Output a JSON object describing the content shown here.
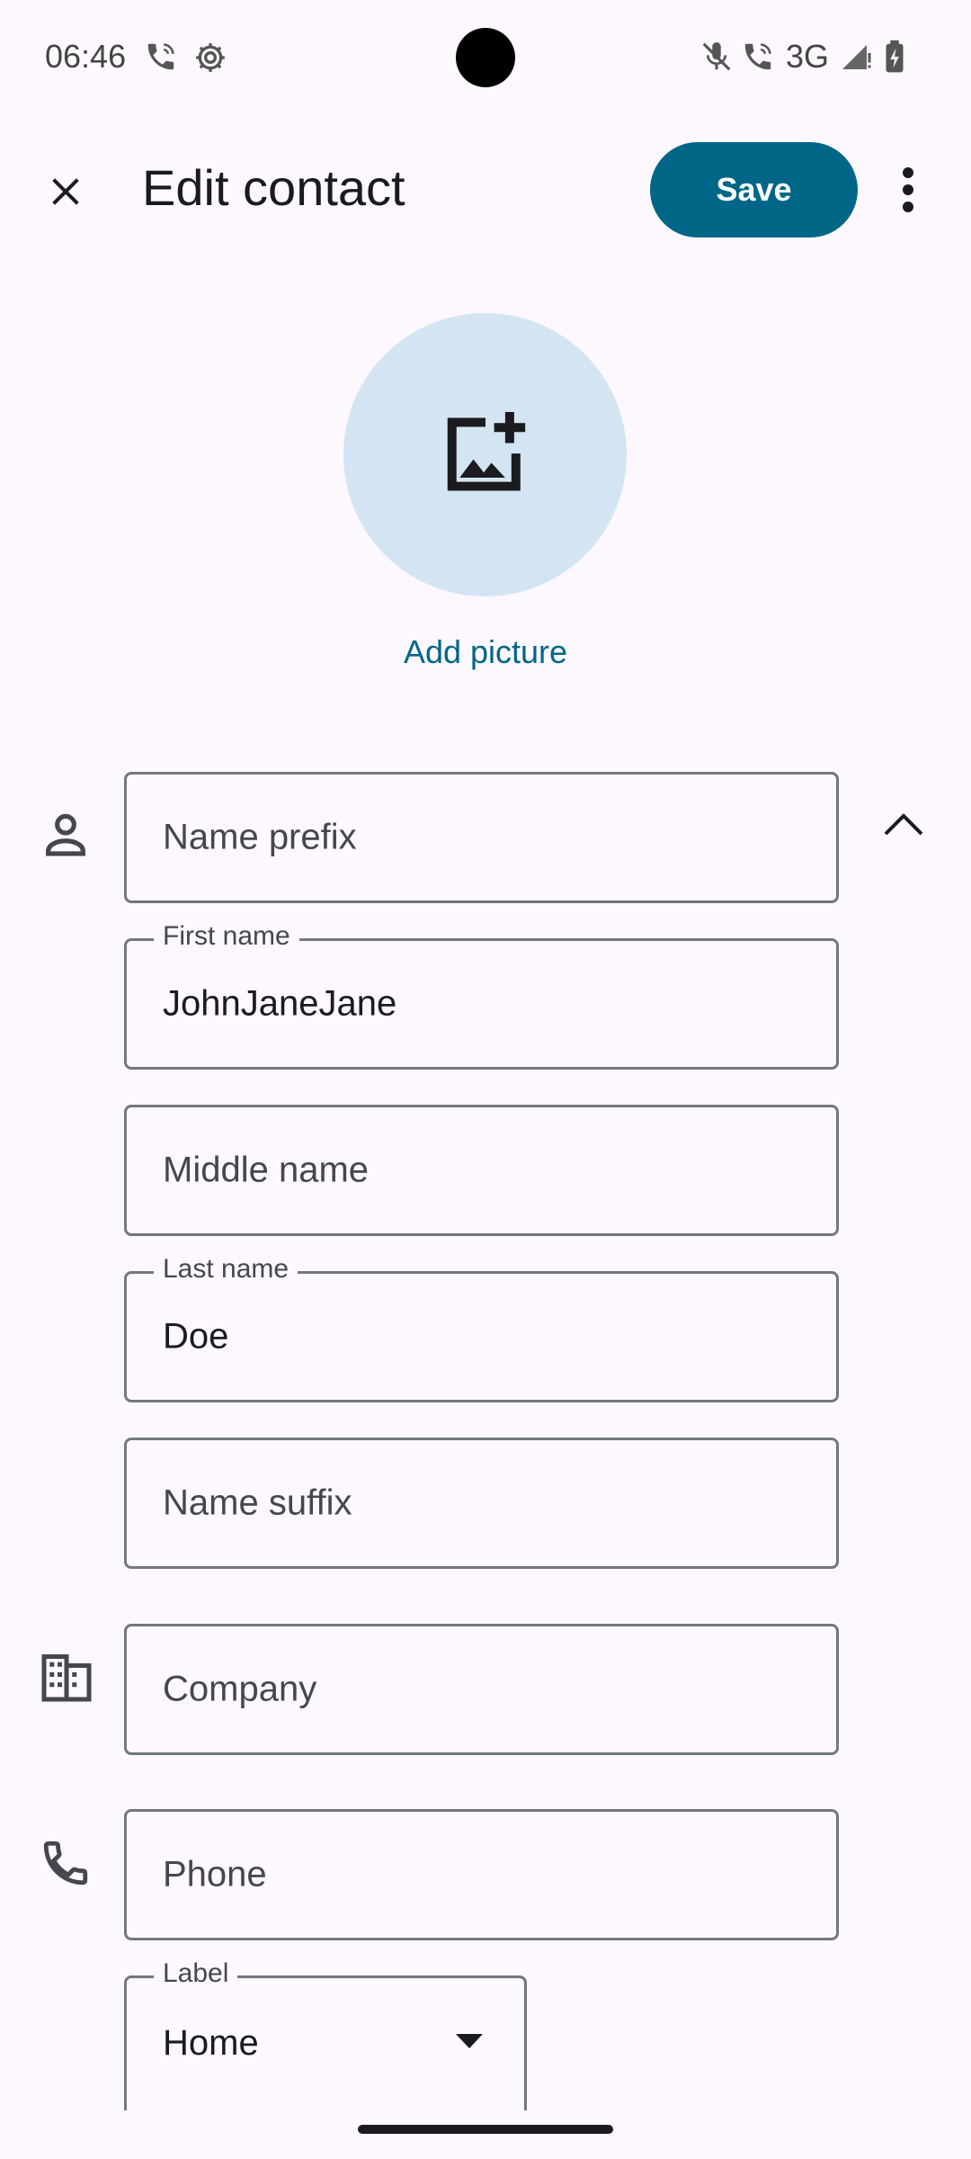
{
  "status_bar": {
    "time": "06:46",
    "network": "3G",
    "icons": [
      "wifi-calling-icon",
      "settings-icon",
      "mute-icon",
      "call-icon",
      "signal-icon",
      "battery-charging-icon"
    ]
  },
  "app_bar": {
    "title": "Edit contact",
    "save_label": "Save",
    "close_icon": "close-icon",
    "more_icon": "more-vert-icon"
  },
  "avatar": {
    "add_picture_label": "Add picture",
    "icon": "add-photo-icon"
  },
  "fields": {
    "name_prefix": {
      "placeholder": "Name prefix",
      "value": ""
    },
    "first_name": {
      "label": "First name",
      "value": "JohnJaneJane"
    },
    "middle_name": {
      "placeholder": "Middle name",
      "value": ""
    },
    "last_name": {
      "label": "Last name",
      "value": "Doe"
    },
    "name_suffix": {
      "placeholder": "Name suffix",
      "value": ""
    },
    "company": {
      "placeholder": "Company",
      "value": ""
    },
    "phone": {
      "placeholder": "Phone",
      "value": ""
    },
    "phone_label": {
      "label": "Label",
      "value": "Home"
    }
  },
  "colors": {
    "accent": "#006687",
    "avatar_bg": "#d3e5f3",
    "background": "#fcf8fd",
    "outline": "#74777f"
  }
}
